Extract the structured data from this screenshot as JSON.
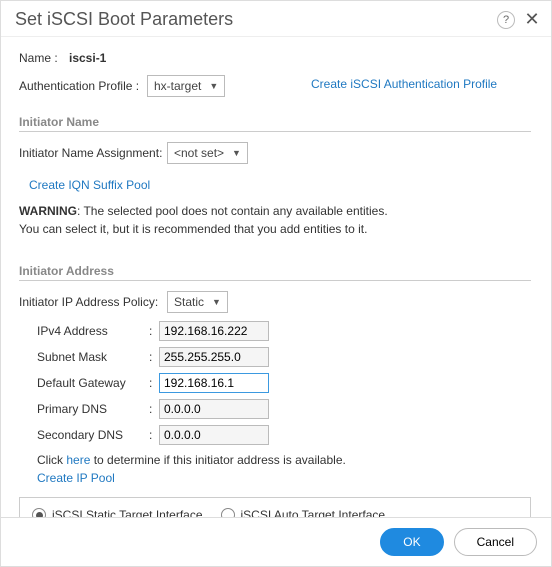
{
  "dialog": {
    "title": "Set iSCSI Boot Parameters",
    "ok_label": "OK",
    "cancel_label": "Cancel"
  },
  "general": {
    "name_label": "Name :",
    "name_value": "iscsi-1",
    "auth_profile_label": "Authentication Profile :",
    "auth_profile_value": "hx-target",
    "create_auth_profile_link": "Create iSCSI Authentication Profile"
  },
  "initiator_name": {
    "section_title": "Initiator Name",
    "assignment_label": "Initiator Name Assignment:",
    "assignment_value": "<not set>",
    "create_iqn_link": "Create IQN Suffix Pool",
    "warning_bold": "WARNING",
    "warning_line1": ": The selected pool does not contain any available entities.",
    "warning_line2": "You can select it, but it is recommended that you add entities to it."
  },
  "initiator_address": {
    "section_title": "Initiator Address",
    "policy_label": "Initiator IP Address Policy:",
    "policy_value": "Static",
    "fields": {
      "ipv4_label": "IPv4 Address",
      "ipv4_value": "192.168.16.222",
      "subnet_label": "Subnet Mask",
      "subnet_value": "255.255.255.0",
      "gw_label": "Default Gateway",
      "gw_value": "192.168.16.1",
      "pdns_label": "Primary DNS",
      "pdns_value": "0.0.0.0",
      "sdns_label": "Secondary DNS",
      "sdns_value": "0.0.0.0"
    },
    "check_prefix": "Click ",
    "check_link": "here",
    "check_suffix": " to determine if this initiator address is available.",
    "create_ip_pool_link": "Create IP Pool"
  },
  "target": {
    "static_label": "iSCSI Static Target Interface",
    "auto_label": "iSCSI Auto Target Interface",
    "selected": "static"
  }
}
